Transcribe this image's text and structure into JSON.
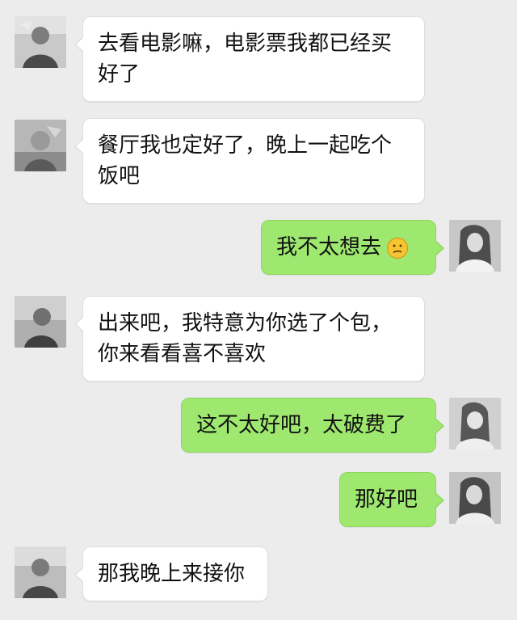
{
  "messages": [
    {
      "side": "incoming",
      "text": "去看电影嘛，电影票我都已经买好了"
    },
    {
      "side": "incoming",
      "text": "餐厅我也定好了，晚上一起吃个饭吧"
    },
    {
      "side": "outgoing",
      "text": "我不太想去",
      "emoji": "confused-face-icon"
    },
    {
      "side": "incoming",
      "text": "出来吧，我特意为你选了个包，你来看看喜不喜欢"
    },
    {
      "side": "outgoing",
      "text": "这不太好吧，太破费了"
    },
    {
      "side": "outgoing",
      "text": "那好吧"
    },
    {
      "side": "incoming",
      "text": "那我晚上来接你"
    }
  ],
  "colors": {
    "background": "#ececec",
    "incoming_bubble": "#ffffff",
    "outgoing_bubble": "#9ee870",
    "text": "#111111"
  }
}
